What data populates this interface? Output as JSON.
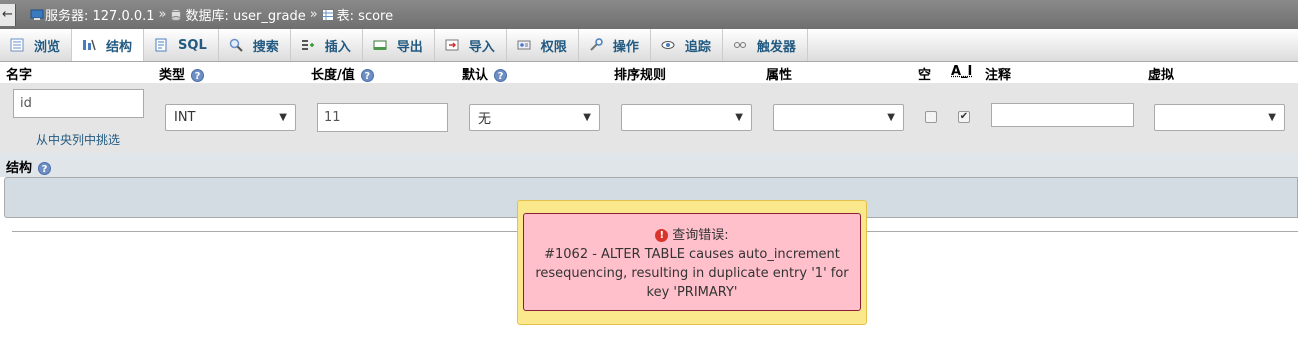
{
  "breadcrumb": {
    "back": "←",
    "server": "服务器: 127.0.0.1",
    "sep1": "»",
    "database": "数据库: user_grade",
    "sep2": "»",
    "table": "表: score"
  },
  "tabs": [
    {
      "label": "浏览",
      "icon": "browse-icon"
    },
    {
      "label": "结构",
      "icon": "structure-icon",
      "active": true
    },
    {
      "label": "SQL",
      "icon": "sql-icon"
    },
    {
      "label": "搜索",
      "icon": "search-icon"
    },
    {
      "label": "插入",
      "icon": "insert-icon"
    },
    {
      "label": "导出",
      "icon": "export-icon"
    },
    {
      "label": "导入",
      "icon": "import-icon"
    },
    {
      "label": "权限",
      "icon": "privileges-icon"
    },
    {
      "label": "操作",
      "icon": "operations-icon"
    },
    {
      "label": "追踪",
      "icon": "tracking-icon"
    },
    {
      "label": "触发器",
      "icon": "triggers-icon"
    }
  ],
  "columns": {
    "name": "名字",
    "type": "类型",
    "length": "长度/值",
    "default": "默认",
    "collation": "排序规则",
    "attributes": "属性",
    "null": "空",
    "ai": "A_I",
    "comment": "注释",
    "virtual": "虚拟"
  },
  "field": {
    "name_value": "id",
    "pick_link": "从中央列中挑选",
    "type_value": "INT",
    "length_value": "11",
    "default_value": "无",
    "collation_value": "",
    "attributes_value": "",
    "null_checked": false,
    "ai_checked": true,
    "comment_value": "",
    "virtual_value": ""
  },
  "structure": {
    "heading": "结构"
  },
  "error": {
    "title": "查询错误:",
    "message": "#1062 - ALTER TABLE causes auto_increment resequencing, resulting in duplicate entry '1' for key 'PRIMARY'"
  },
  "colors": {
    "link": "#235a81",
    "error_bg": "#ffc0cb",
    "overlay": "#fbe88c"
  }
}
